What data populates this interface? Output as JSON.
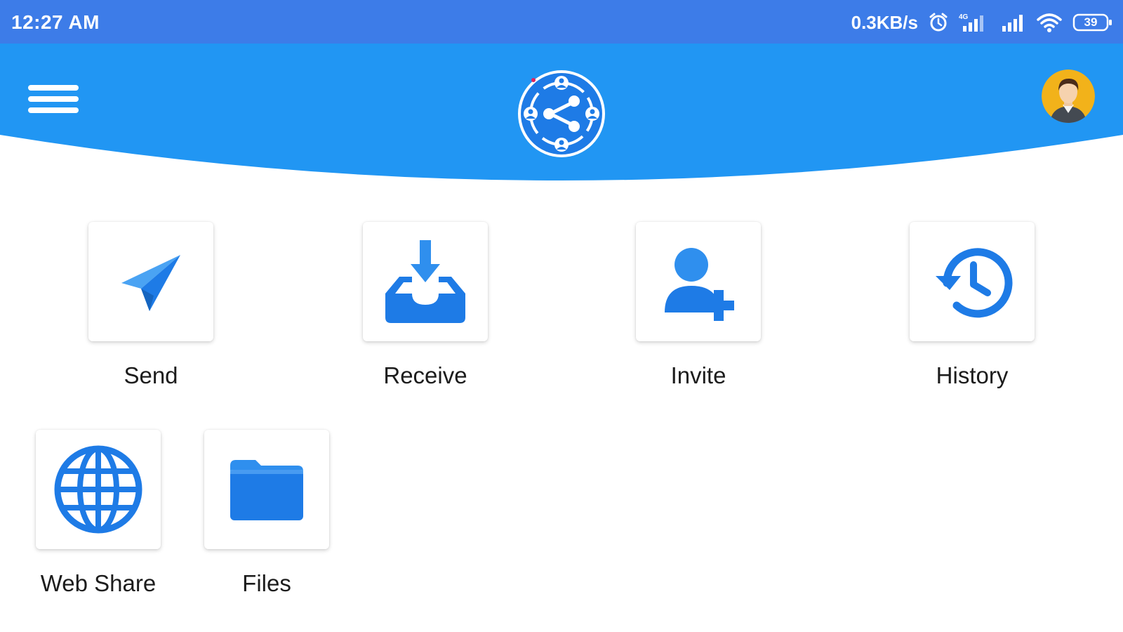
{
  "status_bar": {
    "time": "12:27 AM",
    "network_speed": "0.3KB/s",
    "battery_level": "39",
    "icons": [
      "alarm-icon",
      "signal-4g-icon",
      "signal-icon",
      "wifi-icon",
      "battery-icon"
    ]
  },
  "header": {
    "menu_icon": "hamburger-menu-icon",
    "logo_icon": "share-network-logo",
    "avatar_icon": "user-avatar",
    "accent_color": "#2196f3"
  },
  "tiles": [
    {
      "label": "Send",
      "icon": "paper-plane-icon"
    },
    {
      "label": "Receive",
      "icon": "inbox-download-icon"
    },
    {
      "label": "Invite",
      "icon": "add-user-icon"
    },
    {
      "label": "History",
      "icon": "history-clock-icon"
    },
    {
      "label": "Web Share",
      "icon": "globe-icon"
    },
    {
      "label": "Files",
      "icon": "folder-icon"
    }
  ]
}
